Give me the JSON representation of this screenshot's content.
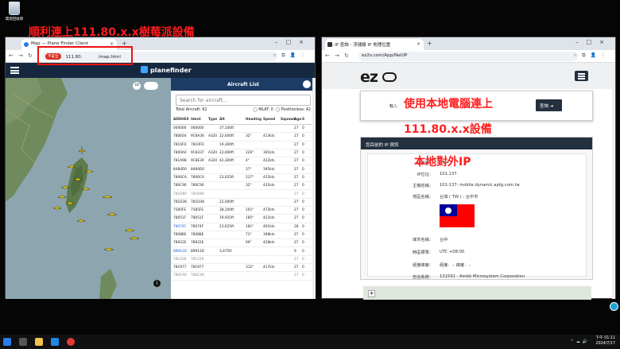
{
  "desktop": {
    "recycle_label": "資源回收筒"
  },
  "annotations": {
    "a1": "順利連上111.80.x.x樹莓派設備",
    "a2": "使用本地電腦連上",
    "a3": "111.80.x.x設備",
    "a4": "本地對外IP"
  },
  "left_browser": {
    "tab_title": "Map — Plane Finder Client",
    "not_secure": "不安全",
    "url_host": "111.80.",
    "url_path": "/map.html",
    "app_name": "planefinder",
    "list_title": "Aircraft List",
    "search_placeholder": "Search for aircraft...",
    "total": "Total Aircraft: 62",
    "mlat": "MLAT: 0",
    "positionless": "Positionless: 42",
    "map_btn_3d": "3D",
    "columns": [
      "ADSHEX",
      "Ident",
      "Type",
      "Alt",
      "Heading",
      "Speed",
      "Squawk",
      "Age",
      "S"
    ],
    "rows": [
      [
        "000000",
        "000000",
        "",
        "37,100ft",
        "",
        "",
        "",
        "27",
        "0"
      ],
      [
        "780E04",
        "9C8A36",
        "A320",
        "22,600ft",
        "32°",
        "413kts",
        "",
        "27",
        "0"
      ],
      [
        "7810FD",
        "7810FD",
        "",
        "19,300ft",
        "",
        "",
        "",
        "27",
        "0"
      ],
      [
        "7800A0",
        "9C8337",
        "A320",
        "22,600ft",
        "226°",
        "391kts",
        "",
        "27",
        "0"
      ],
      [
        "781A9B",
        "9C8E39",
        "A320",
        "42,300ft",
        "4°",
        "422kts",
        "",
        "27",
        "0"
      ],
      [
        "8484D0",
        "8484D0",
        "",
        "",
        "37°",
        "395kts",
        "",
        "27",
        "0"
      ],
      [
        "7806CA",
        "7806CA",
        "",
        "23,025ft",
        "237°",
        "432kts",
        "",
        "27",
        "0"
      ],
      [
        "780C90",
        "780C90",
        "",
        "",
        "32°",
        "431kts",
        "",
        "27",
        "0"
      ],
      [
        "781D90",
        "781D90",
        "",
        "",
        "",
        "",
        "",
        "27",
        "0"
      ],
      [
        "781D36",
        "781D36",
        "",
        "22,000ft",
        "",
        "",
        "",
        "27",
        "0"
      ],
      [
        "7585FE",
        "7585FE",
        "",
        "38,100ft",
        "101°",
        "472kts",
        "",
        "27",
        "0"
      ],
      [
        "78051F",
        "78051F",
        "",
        "19,925ft",
        "185°",
        "421kts",
        "",
        "27",
        "0"
      ],
      [
        "78074F",
        "78074F",
        "",
        "23,625ft",
        "181°",
        "401kts",
        "",
        "28",
        "0"
      ],
      [
        "78088E",
        "78088E",
        "",
        "",
        "73°",
        "398kts",
        "",
        "27",
        "0"
      ],
      [
        "78922E",
        "78922E",
        "",
        "",
        "99°",
        "428kts",
        "",
        "27",
        "0"
      ],
      [
        "89913D",
        "89913D",
        "",
        "3,475ft",
        "",
        "",
        "",
        "9",
        "0"
      ],
      [
        "781226",
        "781226",
        "",
        "",
        "",
        "",
        "",
        "27",
        "0"
      ],
      [
        "781977",
        "781977",
        "",
        "",
        "312°",
        "417kts",
        "",
        "27",
        "0"
      ],
      [
        "780CA6",
        "780CA6",
        "",
        "",
        "",
        "",
        "",
        "27",
        "0"
      ]
    ]
  },
  "right_browser": {
    "tab_title": "IP 查詢 - 浮捷線 IP 地理位置",
    "url": "ez2o.com/App/Net/IP",
    "logo": "ez",
    "input_label": "輸入",
    "query_btn": "查詢 ➜",
    "section_title": "您目前的 IP 資訊",
    "fields": [
      {
        "k": "IP類型：",
        "v": "IPV4"
      },
      {
        "k": "IP位址：",
        "v": "101.137."
      },
      {
        "k": "主機名稱：",
        "v": "101-137-          mobile.dynamic.aptg.com.tw"
      },
      {
        "k": "地區名稱：",
        "v": "台灣 ( TW ) - 台中市"
      },
      {
        "k": "城市名稱：",
        "v": "台中"
      },
      {
        "k": "時區標準：",
        "v": "UTC +08:00"
      },
      {
        "k": "經度緯度：",
        "v": "經度：-.       緯度：-."
      },
      {
        "k": "自治系統：",
        "v": "131591 - Ambit Microsystem Corporation"
      }
    ]
  },
  "taskbar": {
    "time": "下午 01:11",
    "date": "2024/7/17"
  }
}
